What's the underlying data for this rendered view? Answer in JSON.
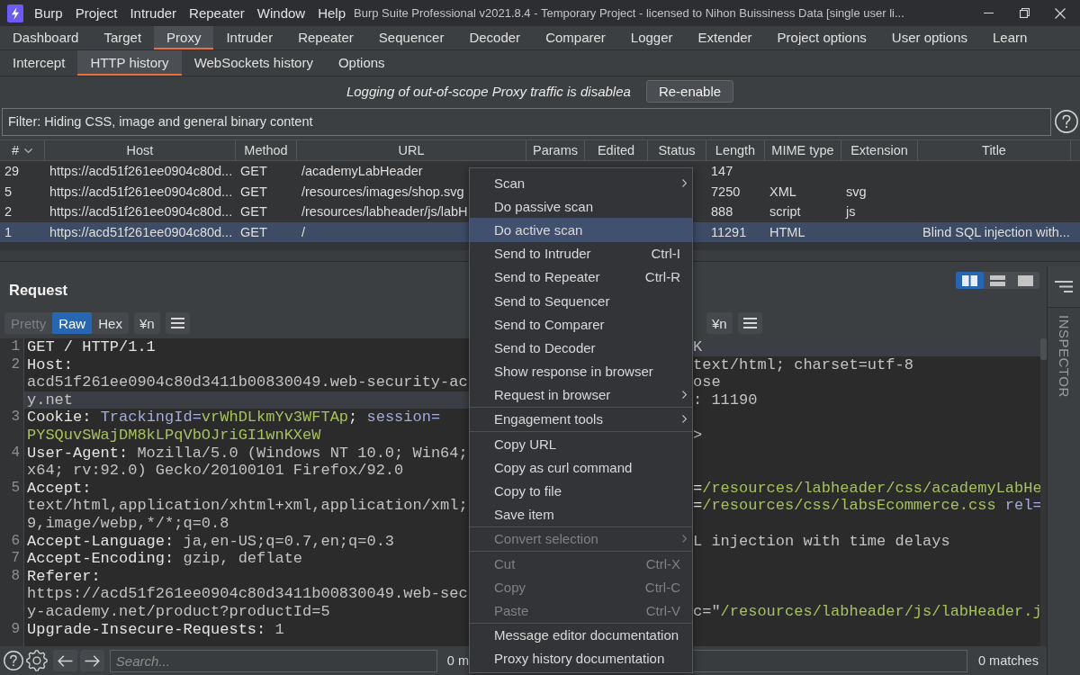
{
  "window": {
    "title": "Burp Suite Professional v2021.8.4 - Temporary Project - licensed to Nihon Buissiness Data [single user li..."
  },
  "menu_bar": [
    "Burp",
    "Project",
    "Intruder",
    "Repeater",
    "Window",
    "Help"
  ],
  "tabs": [
    {
      "label": "Dashboard",
      "selected": false
    },
    {
      "label": "Target",
      "selected": false
    },
    {
      "label": "Proxy",
      "selected": true
    },
    {
      "label": "Intruder",
      "selected": false
    },
    {
      "label": "Repeater",
      "selected": false
    },
    {
      "label": "Sequencer",
      "selected": false
    },
    {
      "label": "Decoder",
      "selected": false
    },
    {
      "label": "Comparer",
      "selected": false
    },
    {
      "label": "Logger",
      "selected": false
    },
    {
      "label": "Extender",
      "selected": false
    },
    {
      "label": "Project options",
      "selected": false
    },
    {
      "label": "User options",
      "selected": false
    },
    {
      "label": "Learn",
      "selected": false
    }
  ],
  "sub_tabs": [
    {
      "label": "Intercept",
      "selected": false
    },
    {
      "label": "HTTP history",
      "selected": true
    },
    {
      "label": "WebSockets history",
      "selected": false
    },
    {
      "label": "Options",
      "selected": false
    }
  ],
  "notice": {
    "text": "Logging of out-of-scope Proxy traffic is disablea",
    "button": "Re-enable"
  },
  "filter": {
    "value": "Filter: Hiding CSS, image and general binary content"
  },
  "table": {
    "columns": [
      {
        "label": "#",
        "sorted": true
      },
      {
        "label": "Host",
        "sorted": false
      },
      {
        "label": "Method",
        "sorted": false
      },
      {
        "label": "URL",
        "sorted": false
      },
      {
        "label": "Params",
        "sorted": false
      },
      {
        "label": "Edited",
        "sorted": false
      },
      {
        "label": "Status",
        "sorted": false
      },
      {
        "label": "Length",
        "sorted": false
      },
      {
        "label": "MIME type",
        "sorted": false
      },
      {
        "label": "Extension",
        "sorted": false
      },
      {
        "label": "Title",
        "sorted": false
      }
    ],
    "rows": [
      {
        "selected": false,
        "number": "29",
        "host": "https://acd51f261ee0904c80d...",
        "method": "GET",
        "url": "/academyLabHeader",
        "length": "147"
      },
      {
        "selected": false,
        "number": "5",
        "host": "https://acd51f261ee0904c80d...",
        "method": "GET",
        "url": "/resources/images/shop.svg",
        "length": "7250",
        "mime_type": "XML",
        "extension": "svg"
      },
      {
        "selected": false,
        "number": "2",
        "host": "https://acd51f261ee0904c80d...",
        "method": "GET",
        "url": "/resources/labheader/js/labH",
        "length": "888",
        "mime_type": "script",
        "extension": "js"
      },
      {
        "selected": true,
        "number": "1",
        "host": "https://acd51f261ee0904c80d...",
        "method": "GET",
        "url": "/",
        "length": "11291",
        "mime_type": "HTML",
        "title": "Blind SQL injection with..."
      }
    ]
  },
  "request": {
    "title": "Request",
    "view_tabs": [
      {
        "label": "Pretty",
        "selected": false,
        "disabled": true
      },
      {
        "label": "Raw",
        "selected": true,
        "disabled": false
      },
      {
        "label": "Hex",
        "selected": false,
        "disabled": false
      }
    ],
    "newline_button": "¥n",
    "rows": [
      {
        "number": "1",
        "highlighted": false,
        "segments": [
          {
            "kind": "name",
            "text": "GET / HTTP/1.1"
          }
        ]
      },
      {
        "number": "2",
        "highlighted": false,
        "segments": [
          {
            "kind": "name",
            "text": "Host:"
          }
        ]
      },
      {
        "highlighted": false,
        "segments": [
          {
            "kind": "value",
            "text": "acd51f261ee0904c80d3411b00830049.web-security-ac"
          }
        ]
      },
      {
        "highlighted": true,
        "segments": [
          {
            "kind": "value",
            "text": "y.net"
          }
        ]
      },
      {
        "number": "3",
        "highlighted": false,
        "segments": [
          {
            "kind": "name",
            "text": "Cookie: "
          },
          {
            "kind": "param",
            "text": "TrackingId="
          },
          {
            "kind": "param_value",
            "text": "vrWhDLkmYv3WFTAp"
          },
          {
            "kind": "name",
            "text": "; "
          },
          {
            "kind": "param",
            "text": "session="
          }
        ]
      },
      {
        "highlighted": false,
        "segments": [
          {
            "kind": "param_value",
            "text": "PYSQuvSWajDM8kLPqVbOJriGI1wnKXeW"
          }
        ]
      },
      {
        "number": "4",
        "highlighted": false,
        "segments": [
          {
            "kind": "name",
            "text": "User-Agent: "
          },
          {
            "kind": "value",
            "text": "Mozilla/5.0 (Windows NT 10.0; Win64;"
          }
        ]
      },
      {
        "highlighted": false,
        "segments": [
          {
            "kind": "value",
            "text": "x64; rv:92.0) Gecko/20100101 Firefox/92.0"
          }
        ]
      },
      {
        "number": "5",
        "highlighted": false,
        "segments": [
          {
            "kind": "name",
            "text": "Accept:"
          }
        ]
      },
      {
        "highlighted": false,
        "segments": [
          {
            "kind": "value",
            "text": "text/html,application/xhtml+xml,application/xml;"
          }
        ]
      },
      {
        "highlighted": false,
        "segments": [
          {
            "kind": "value",
            "text": "9,image/webp,*/*;q=0.8"
          }
        ]
      },
      {
        "number": "6",
        "highlighted": false,
        "segments": [
          {
            "kind": "name",
            "text": "Accept-Language: "
          },
          {
            "kind": "value",
            "text": "ja,en-US;q=0.7,en;q=0.3"
          }
        ]
      },
      {
        "number": "7",
        "highlighted": false,
        "segments": [
          {
            "kind": "name",
            "text": "Accept-Encoding: "
          },
          {
            "kind": "value",
            "text": "gzip, deflate"
          }
        ]
      },
      {
        "number": "8",
        "highlighted": false,
        "segments": [
          {
            "kind": "name",
            "text": "Referer:"
          }
        ]
      },
      {
        "highlighted": false,
        "segments": [
          {
            "kind": "value",
            "text": "https://acd51f261ee0904c80d3411b00830049.web-sec"
          }
        ]
      },
      {
        "highlighted": false,
        "segments": [
          {
            "kind": "value",
            "text": "y-academy.net/product?productId=5"
          }
        ]
      },
      {
        "number": "9",
        "highlighted": false,
        "segments": [
          {
            "kind": "name",
            "text": "Upgrade-Insecure-Requests: "
          },
          {
            "kind": "value",
            "text": "1"
          }
        ]
      }
    ],
    "search": {
      "placeholder": "Search..."
    },
    "match_count": "0 m"
  },
  "response": {
    "newline_button": "¥n",
    "rows": [
      {
        "kind": "text",
        "highlighted": true,
        "segments": [
          {
            "kind": "value",
            "text": "K"
          }
        ]
      },
      {
        "kind": "text",
        "highlighted": false,
        "segments": [
          {
            "kind": "value",
            "text": "text/html; charset=utf-8"
          }
        ]
      },
      {
        "kind": "text",
        "highlighted": false,
        "segments": [
          {
            "kind": "value",
            "text": "ose"
          }
        ]
      },
      {
        "kind": "text",
        "highlighted": false,
        "segments": [
          {
            "kind": "value",
            "text": ": 11190"
          }
        ]
      },
      {
        "kind": "blank",
        "highlighted": false
      },
      {
        "kind": "text",
        "highlighted": false,
        "segments": [
          {
            "kind": "value",
            "text": ">"
          }
        ]
      },
      {
        "kind": "blank",
        "highlighted": false
      },
      {
        "kind": "blank",
        "highlighted": false
      },
      {
        "kind": "text",
        "highlighted": false,
        "segments": [
          {
            "kind": "name",
            "text": "="
          },
          {
            "kind": "param_value",
            "text": "/resources/labheader/css/academyLabHe"
          }
        ]
      },
      {
        "kind": "text",
        "highlighted": false,
        "segments": [
          {
            "kind": "name",
            "text": "="
          },
          {
            "kind": "param_value",
            "text": "/resources/css/labsEcommerce.css"
          },
          {
            "kind": "param",
            "text": " rel="
          }
        ]
      },
      {
        "kind": "blank",
        "highlighted": false
      },
      {
        "kind": "text",
        "highlighted": false,
        "segments": [
          {
            "kind": "value",
            "text": "L injection with time delays"
          }
        ]
      },
      {
        "kind": "blank",
        "highlighted": false
      },
      {
        "kind": "blank",
        "highlighted": false
      },
      {
        "kind": "blank",
        "highlighted": false
      },
      {
        "kind": "text",
        "highlighted": false,
        "segments": [
          {
            "kind": "value",
            "text": "c=\""
          },
          {
            "kind": "param_value",
            "text": "/resources/labheader/js/labHeader.j"
          }
        ]
      },
      {
        "kind": "blank",
        "highlighted": false
      }
    ],
    "match_count": "0 matches"
  },
  "layout_buttons": [
    {
      "kind": "side_by_side",
      "selected": true
    },
    {
      "kind": "stacked",
      "selected": false
    },
    {
      "kind": "single",
      "selected": false
    }
  ],
  "inspector": {
    "label": "INSPECTOR"
  },
  "context_menu": {
    "groups": [
      [
        {
          "label": "Scan",
          "submenu": true,
          "disabled": false,
          "highlighted": false
        },
        {
          "label": "Do passive scan",
          "submenu": false,
          "disabled": false,
          "highlighted": false
        },
        {
          "label": "Do active scan",
          "submenu": false,
          "disabled": false,
          "highlighted": true
        },
        {
          "label": "Send to Intruder",
          "shortcut": "Ctrl-I",
          "submenu": false,
          "disabled": false,
          "highlighted": false
        },
        {
          "label": "Send to Repeater",
          "shortcut": "Ctrl-R",
          "submenu": false,
          "disabled": false,
          "highlighted": false
        },
        {
          "label": "Send to Sequencer",
          "submenu": false,
          "disabled": false,
          "highlighted": false
        },
        {
          "label": "Send to Comparer",
          "submenu": false,
          "disabled": false,
          "highlighted": false
        },
        {
          "label": "Send to Decoder",
          "submenu": false,
          "disabled": false,
          "highlighted": false
        },
        {
          "label": "Show response in browser",
          "submenu": false,
          "disabled": false,
          "highlighted": false
        },
        {
          "label": "Request in browser",
          "submenu": true,
          "disabled": false,
          "highlighted": false
        }
      ],
      [
        {
          "label": "Engagement tools",
          "submenu": true,
          "disabled": false,
          "highlighted": false
        }
      ],
      [
        {
          "label": "Copy URL",
          "submenu": false,
          "disabled": false,
          "highlighted": false
        },
        {
          "label": "Copy as curl command",
          "submenu": false,
          "disabled": false,
          "highlighted": false
        },
        {
          "label": "Copy to file",
          "submenu": false,
          "disabled": false,
          "highlighted": false
        },
        {
          "label": "Save item",
          "submenu": false,
          "disabled": false,
          "highlighted": false
        }
      ],
      [
        {
          "label": "Convert selection",
          "submenu": true,
          "disabled": true,
          "highlighted": false
        }
      ],
      [
        {
          "label": "Cut",
          "shortcut": "Ctrl-X",
          "submenu": false,
          "disabled": true,
          "highlighted": false
        },
        {
          "label": "Copy",
          "shortcut": "Ctrl-C",
          "submenu": false,
          "disabled": true,
          "highlighted": false
        },
        {
          "label": "Paste",
          "shortcut": "Ctrl-V",
          "submenu": false,
          "disabled": true,
          "highlighted": false
        }
      ],
      [
        {
          "label": "Message editor documentation",
          "submenu": false,
          "disabled": false,
          "highlighted": false
        },
        {
          "label": "Proxy history documentation",
          "submenu": false,
          "disabled": false,
          "highlighted": false
        }
      ]
    ]
  }
}
